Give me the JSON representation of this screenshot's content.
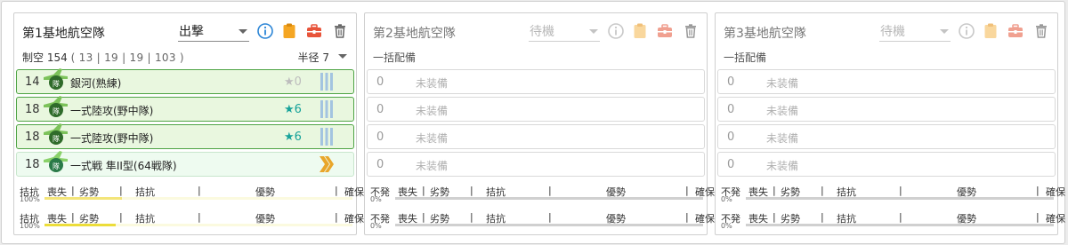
{
  "colors": {
    "equip_bg": "#e9f7df",
    "equip_border": "#4fa445",
    "proficiency_bar": "#a3c4e0",
    "proficiency_chevron": "#e9a62a",
    "star_teal": "#17a39a",
    "info": "#2b85d6",
    "clipboard": "#f5a623",
    "toolbox": "#e8543a",
    "gauge_fill": "#ecdd3a"
  },
  "panels": [
    {
      "title": "第1基地航空隊",
      "mode": "出撃",
      "air_power_label": "制空",
      "air_power_value": "154",
      "air_power_detail": "( 13 | 19 | 19 | 103 )",
      "radius_label": "半径",
      "radius_value": "7",
      "icons": [
        "info-icon",
        "clipboard-icon",
        "toolbox-icon",
        "trash-icon"
      ],
      "slots": [
        {
          "count": "14",
          "name": "銀河(熟練)",
          "stars": "0",
          "proficiency": "bars"
        },
        {
          "count": "18",
          "name": "一式陸攻(野中隊)",
          "stars": "6",
          "proficiency": "bars"
        },
        {
          "count": "18",
          "name": "一式陸攻(野中隊)",
          "stars": "6",
          "proficiency": "bars"
        },
        {
          "count": "18",
          "name": "一式戦 隼II型(64戦隊)",
          "stars": "",
          "proficiency": "chevron"
        }
      ],
      "gauges": [
        {
          "status": "拮抗",
          "pct": "100%",
          "fill": 0.5
        },
        {
          "status": "拮抗",
          "pct": "100%",
          "fill": 0.5
        }
      ]
    },
    {
      "title": "第2基地航空隊",
      "mode": "待機",
      "bulk_label": "一括配備",
      "icons": [
        "info-icon",
        "clipboard-icon",
        "toolbox-icon",
        "trash-icon"
      ],
      "slots": [
        {
          "count": "0",
          "name": "未装備"
        },
        {
          "count": "0",
          "name": "未装備"
        },
        {
          "count": "0",
          "name": "未装備"
        },
        {
          "count": "0",
          "name": "未装備"
        }
      ],
      "gauges": [
        {
          "status": "不発",
          "pct": "0%"
        },
        {
          "status": "不発",
          "pct": "0%"
        }
      ]
    },
    {
      "title": "第3基地航空隊",
      "mode": "待機",
      "bulk_label": "一括配備",
      "icons": [
        "info-icon",
        "clipboard-icon",
        "toolbox-icon",
        "trash-icon"
      ],
      "slots": [
        {
          "count": "0",
          "name": "未装備"
        },
        {
          "count": "0",
          "name": "未装備"
        },
        {
          "count": "0",
          "name": "未装備"
        },
        {
          "count": "0",
          "name": "未装備"
        }
      ],
      "gauges": [
        {
          "status": "不発",
          "pct": "0%"
        },
        {
          "status": "不発",
          "pct": "0%"
        }
      ]
    }
  ],
  "gauge_labels": [
    "喪失",
    "劣勢",
    "拮抗",
    "優勢",
    "確保"
  ]
}
